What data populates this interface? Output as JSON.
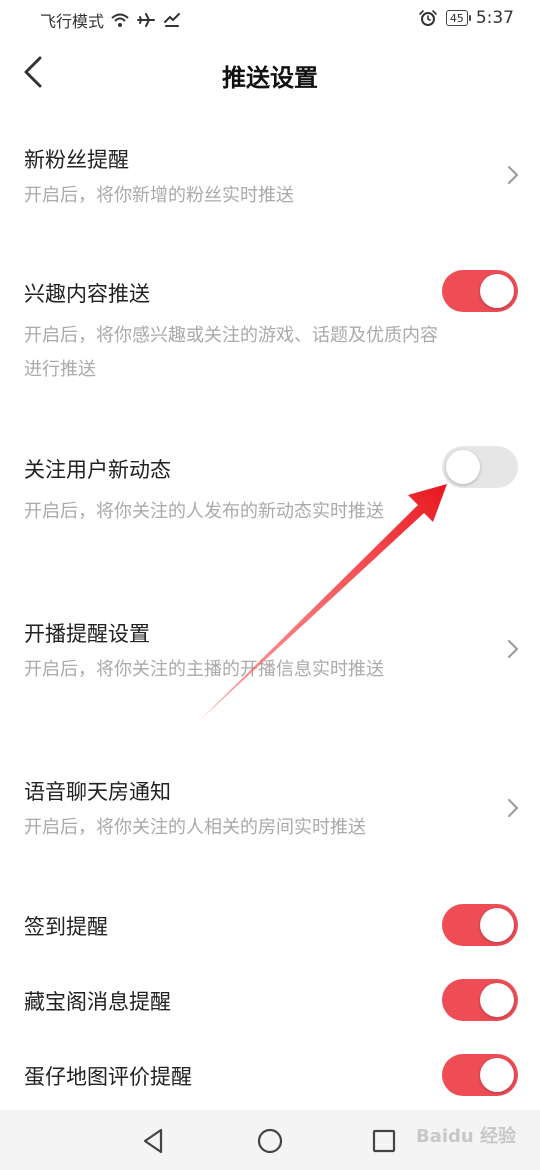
{
  "status_bar": {
    "left_text": "飞行模式",
    "battery": "45",
    "time": "5:37"
  },
  "header": {
    "title": "推送设置"
  },
  "settings": [
    {
      "title": "新粉丝提醒",
      "desc_lines": [
        "开启后，将你新增的粉丝实时推送"
      ],
      "control": "chevron"
    },
    {
      "title": "兴趣内容推送",
      "desc_lines": [
        "开启后，将你感兴趣或关注的游戏、话题及优质内容",
        "进行推送"
      ],
      "control": "toggle",
      "on": true
    },
    {
      "title": "关注用户新动态",
      "desc_lines": [
        "开启后，将你关注的人发布的新动态实时推送"
      ],
      "control": "toggle",
      "on": false
    },
    {
      "title": "开播提醒设置",
      "desc_lines": [
        "开启后，将你关注的主播的开播信息实时推送"
      ],
      "control": "chevron"
    },
    {
      "title": "语音聊天房通知",
      "desc_lines": [
        "开启后，将你关注的人相关的房间实时推送"
      ],
      "control": "chevron"
    },
    {
      "title": "签到提醒",
      "desc_lines": [],
      "control": "toggle",
      "on": true
    },
    {
      "title": "藏宝阁消息提醒",
      "desc_lines": [],
      "control": "toggle",
      "on": true
    },
    {
      "title": "蛋仔地图评价提醒",
      "desc_lines": [],
      "control": "toggle",
      "on": true
    }
  ],
  "watermark": "Baidu 经验",
  "colors": {
    "toggle_on": "#ee4d56",
    "toggle_off": "#e6e6e6",
    "annotation_arrow": "#e8161e"
  },
  "icons": {
    "back": "chevron-left-icon",
    "nav": [
      "back-triangle-icon",
      "home-circle-icon",
      "recents-square-icon"
    ]
  }
}
